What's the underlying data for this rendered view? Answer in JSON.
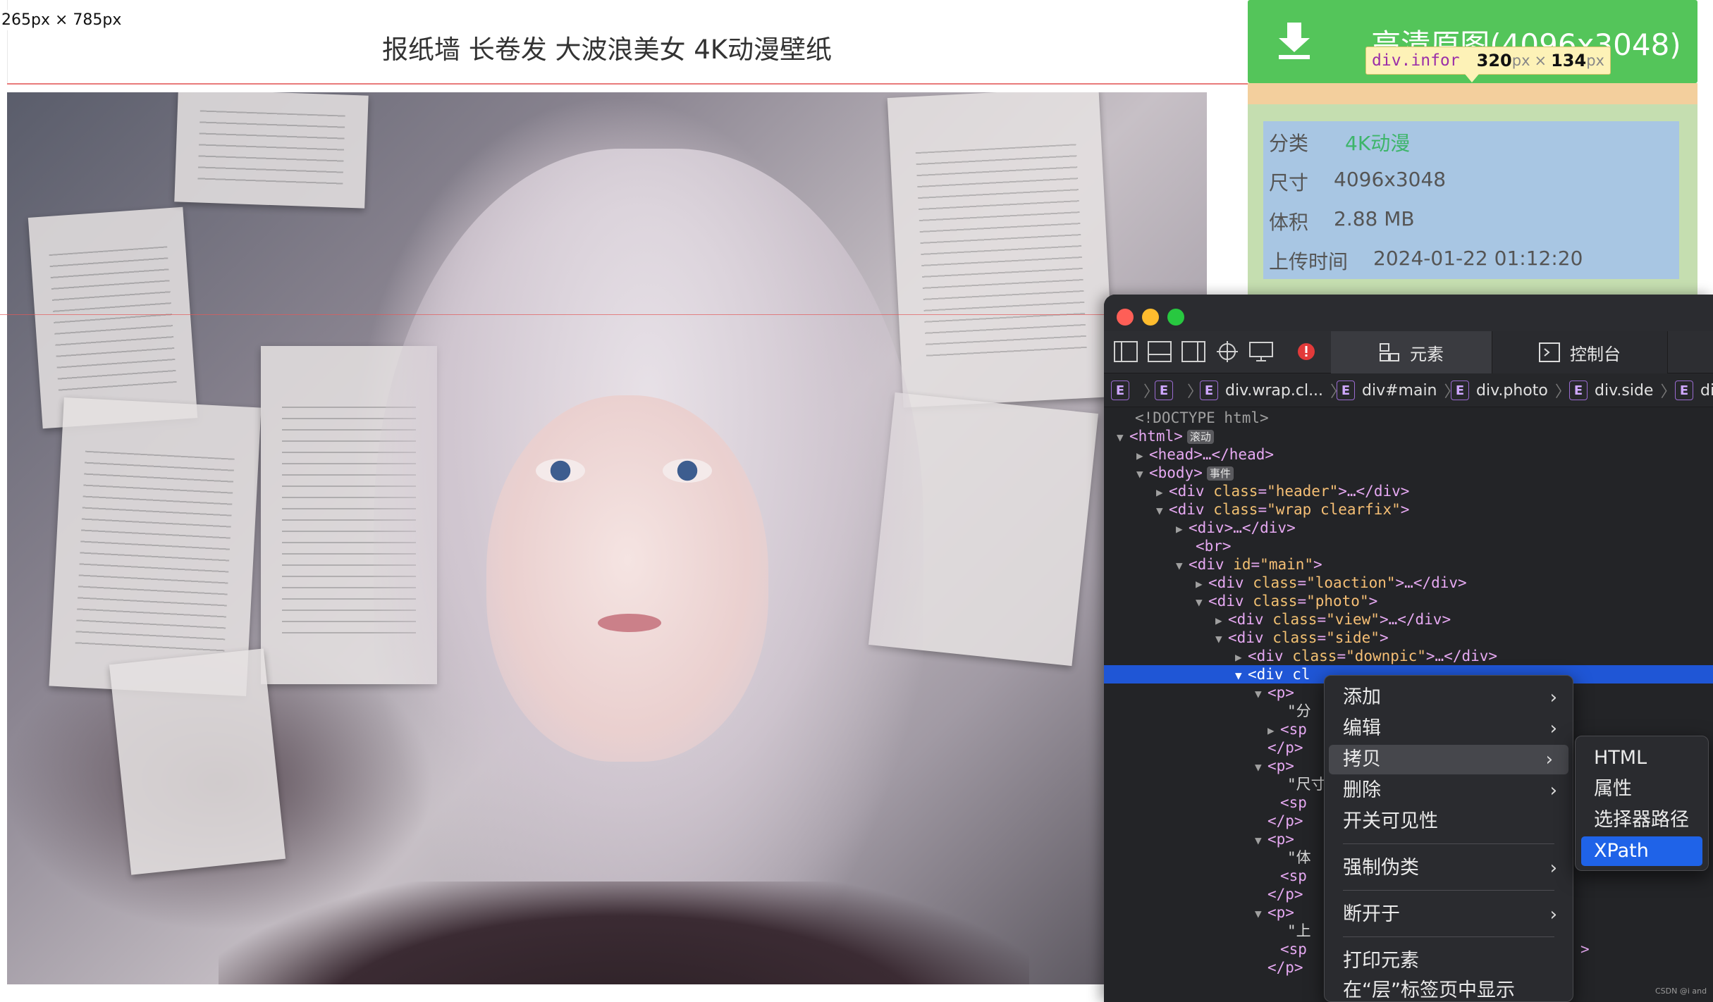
{
  "overlay": {
    "size_badge": "265px × 785px"
  },
  "page": {
    "title": "报纸墙 长卷发 大波浪美女 4K动漫壁纸"
  },
  "download": {
    "label": "高清原图(4096x3048)",
    "icon": "download-arrow-icon"
  },
  "tooltip": {
    "selector": "div.infor",
    "width": "320",
    "height": "134",
    "unit": "px",
    "times": "×"
  },
  "info": {
    "rows": [
      {
        "key": "分类",
        "value": "4K动漫"
      },
      {
        "key": "尺寸",
        "value": "4096x3048"
      },
      {
        "key": "体积",
        "value": "2.88 MB"
      },
      {
        "key": "上传时间",
        "value": "2024-01-22 01:12:20"
      }
    ],
    "colors": {
      "link": "#3db56a",
      "margin": "#f3cf9d",
      "padding": "#c5deb0",
      "content": "#a8c6e3",
      "download_bg": "#54c55a"
    }
  },
  "devtools": {
    "tabs": {
      "elements": "元素",
      "console": "控制台"
    },
    "breadcrumb": {
      "badge": "E",
      "items": [
        "",
        "",
        "div.wrap.cl...",
        "div#main",
        "div.photo",
        "div.side",
        "div"
      ]
    },
    "tree": {
      "doctype": "<!DOCTYPE html>",
      "html_tag": "<html>",
      "scroll_badge": "滚动",
      "head": "<head>…</head>",
      "body_tag": "<body>",
      "event_badge": "事件",
      "l_header": {
        "open": "<div ",
        "attr": "class",
        "eq": "=",
        "val": "\"header\"",
        "close": ">…</div>"
      },
      "l_wrap": {
        "open": "<div ",
        "attr": "class",
        "eq": "=",
        "val": "\"wrap clearfix\"",
        "close": ">"
      },
      "l_div": "<div>…</div>",
      "l_br": "<br>",
      "l_main": {
        "open": "<div ",
        "attr": "id",
        "eq": "=",
        "val": "\"main\"",
        "close": ">"
      },
      "l_loaction": {
        "open": "<div ",
        "attr": "class",
        "eq": "=",
        "val": "\"loaction\"",
        "close": ">…</div>"
      },
      "l_photo": {
        "open": "<div ",
        "attr": "class",
        "eq": "=",
        "val": "\"photo\"",
        "close": ">"
      },
      "l_view": {
        "open": "<div ",
        "attr": "class",
        "eq": "=",
        "val": "\"view\"",
        "close": ">…</div>"
      },
      "l_side": {
        "open": "<div ",
        "attr": "class",
        "eq": "=",
        "val": "\"side\"",
        "close": ">"
      },
      "l_downpic": {
        "open": "<div ",
        "attr": "class",
        "eq": "=",
        "val": "\"downpic\"",
        "close": ">…</div>"
      },
      "l_selected": "<div cl",
      "p_open": "<p>",
      "p_close": "</p>",
      "sp_open": "<sp",
      "t_fen": "\"分",
      "t_chi": "\"尺寸",
      "t_ti": "\"体",
      "t_shang": "\"上",
      "tail": ">"
    }
  },
  "context_menu": {
    "items": [
      "添加",
      "编辑",
      "拷贝",
      "删除",
      "开关可见性",
      "强制伪类",
      "断开于",
      "打印元素",
      "在“层”标签页中显示"
    ],
    "submenu": [
      "HTML",
      "属性",
      "选择器路径",
      "XPath"
    ]
  },
  "watermark": "CSDN @i and"
}
